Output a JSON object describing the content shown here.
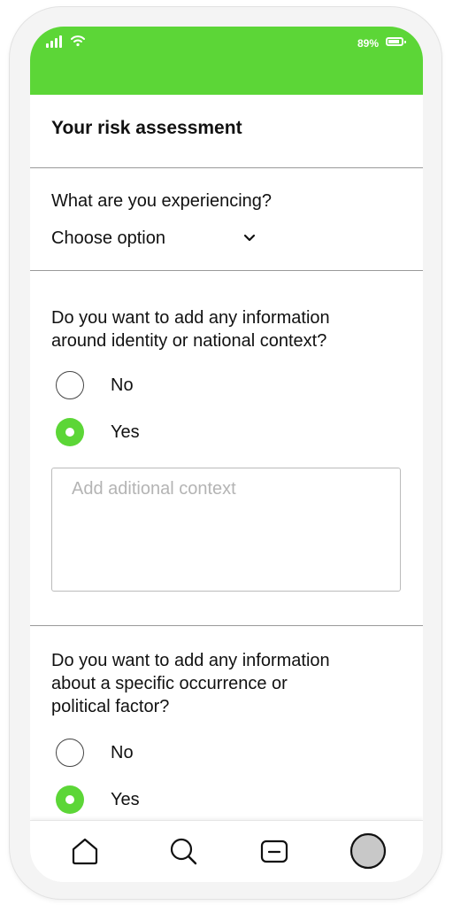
{
  "status_bar": {
    "battery": "89%",
    "accent_color": "#5cd637"
  },
  "header": {
    "title": "Your risk assessment"
  },
  "question_experience": {
    "label": "What are you experiencing?",
    "select_value": "Choose option"
  },
  "question_identity": {
    "label_line1": "Do you want to add any information",
    "label_line2": "around identity or national context?",
    "options": [
      "No",
      "Yes"
    ],
    "selected": "Yes",
    "context_placeholder": "Add aditional context"
  },
  "question_occurrence": {
    "label_line1": "Do you want to add any information",
    "label_line2": "about a specific occurrence or",
    "label_line3": "political factor?",
    "options": [
      "No",
      "Yes"
    ],
    "selected": "Yes"
  },
  "bottom_nav": {
    "items": [
      "home-icon",
      "search-icon",
      "message-icon",
      "profile-avatar"
    ]
  }
}
